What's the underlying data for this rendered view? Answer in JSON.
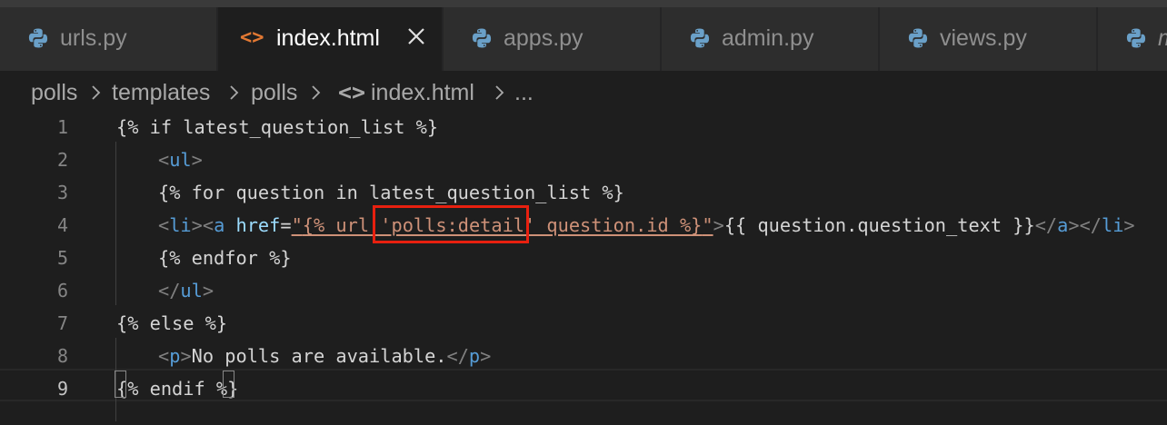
{
  "tabs": [
    {
      "label": "urls.py",
      "icon": "python-icon",
      "active": false
    },
    {
      "label": "index.html",
      "icon": "html-icon",
      "active": true
    },
    {
      "label": "apps.py",
      "icon": "python-icon",
      "active": false
    },
    {
      "label": "admin.py",
      "icon": "python-icon",
      "active": false
    },
    {
      "label": "views.py",
      "icon": "python-icon",
      "active": false
    },
    {
      "label": "m",
      "icon": "python-icon",
      "active": false
    }
  ],
  "html_icon_glyph": "<>",
  "breadcrumb": [
    "polls",
    "templates",
    "polls",
    "index.html",
    "..."
  ],
  "code": {
    "line_numbers": [
      "1",
      "2",
      "3",
      "4",
      "5",
      "6",
      "7",
      "8",
      "9"
    ],
    "lines": [
      [
        {
          "t": "{% if latest_question_list %}",
          "c": "txt"
        }
      ],
      [
        {
          "t": "<",
          "c": "punc"
        },
        {
          "t": "ul",
          "c": "tag"
        },
        {
          "t": ">",
          "c": "punc"
        }
      ],
      [
        {
          "t": "{% for question in latest_question_list %}",
          "c": "txt"
        }
      ],
      [
        {
          "t": "<",
          "c": "punc"
        },
        {
          "t": "li",
          "c": "tag"
        },
        {
          "t": ">",
          "c": "punc"
        },
        {
          "t": "<",
          "c": "punc"
        },
        {
          "t": "a",
          "c": "tag"
        },
        {
          "t": " ",
          "c": "txt"
        },
        {
          "t": "href",
          "c": "attr"
        },
        {
          "t": "=",
          "c": "txt"
        },
        {
          "t": "\"",
          "c": "str"
        },
        {
          "t": "{% url 'polls:detail' question.id %}",
          "c": "str"
        },
        {
          "t": "\"",
          "c": "str"
        },
        {
          "t": ">",
          "c": "punc"
        },
        {
          "t": "{{ question.question_text }}",
          "c": "txt"
        },
        {
          "t": "</",
          "c": "punc"
        },
        {
          "t": "a",
          "c": "tag"
        },
        {
          "t": ">",
          "c": "punc"
        },
        {
          "t": "</",
          "c": "punc"
        },
        {
          "t": "li",
          "c": "tag"
        },
        {
          "t": ">",
          "c": "punc"
        }
      ],
      [
        {
          "t": "{% endfor %}",
          "c": "txt"
        }
      ],
      [
        {
          "t": "</",
          "c": "punc"
        },
        {
          "t": "ul",
          "c": "tag"
        },
        {
          "t": ">",
          "c": "punc"
        }
      ],
      [
        {
          "t": "{% else %}",
          "c": "txt"
        }
      ],
      [
        {
          "t": "<",
          "c": "punc"
        },
        {
          "t": "p",
          "c": "tag"
        },
        {
          "t": ">",
          "c": "punc"
        },
        {
          "t": "No polls are available.",
          "c": "txt"
        },
        {
          "t": "</",
          "c": "punc"
        },
        {
          "t": "p",
          "c": "tag"
        },
        {
          "t": ">",
          "c": "punc"
        }
      ],
      [
        {
          "t": "{% endif %}",
          "c": "txt"
        }
      ]
    ],
    "current_line": "9"
  },
  "colors": {
    "tag": "#569cd6",
    "attribute": "#9cdcfe",
    "string": "#ce9178",
    "highlight_box": "#e8200f",
    "html_icon": "#e37933",
    "python_icon": "#6aa0c8"
  }
}
